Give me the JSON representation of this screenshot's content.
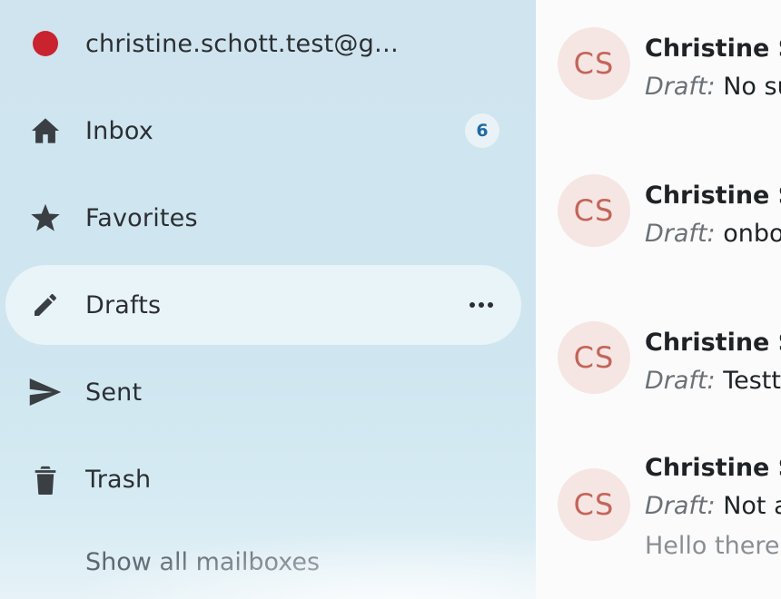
{
  "sidebar": {
    "account": {
      "label": "christine.schott.test@gmx...",
      "color": "#c8232f"
    },
    "items": [
      {
        "key": "inbox",
        "label": "Inbox",
        "icon": "home-icon",
        "badge": "6"
      },
      {
        "key": "favorites",
        "label": "Favorites",
        "icon": "star-icon"
      },
      {
        "key": "drafts",
        "label": "Drafts",
        "icon": "pencil-icon",
        "active": true
      },
      {
        "key": "sent",
        "label": "Sent",
        "icon": "send-icon"
      },
      {
        "key": "trash",
        "label": "Trash",
        "icon": "trash-icon"
      }
    ],
    "show_all": "Show all mailboxes"
  },
  "messages": [
    {
      "avatar": "CS",
      "sender": "Christine S",
      "draft_label": "Draft:",
      "subject": "No su"
    },
    {
      "avatar": "CS",
      "sender": "Christine S",
      "draft_label": "Draft:",
      "subject": "onbo"
    },
    {
      "avatar": "CS",
      "sender": "Christine S",
      "draft_label": "Draft:",
      "subject": "Testte"
    },
    {
      "avatar": "CS",
      "sender": "Christine S",
      "draft_label": "Draft:",
      "subject": "Not a",
      "preview": "Hello there!"
    }
  ],
  "colors": {
    "sidebar_bg": "#cfe4ee",
    "icon": "#3a3f44",
    "badge_text": "#1f6aa5",
    "avatar_bg": "#f5e6e3",
    "avatar_text": "#c4655a"
  }
}
